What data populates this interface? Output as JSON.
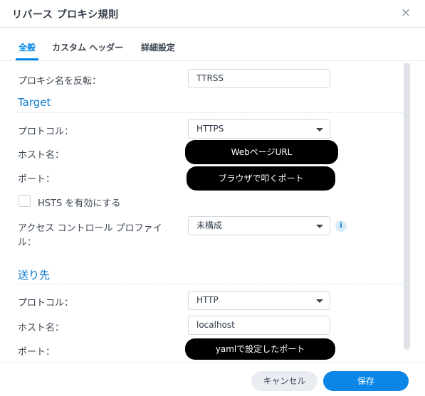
{
  "dialog": {
    "title": "リバース プロキシ規則",
    "close_icon": "×"
  },
  "tabs": [
    {
      "label": "全般",
      "active": true
    },
    {
      "label": "カスタム ヘッダー",
      "active": false
    },
    {
      "label": "詳細設定",
      "active": false
    }
  ],
  "general": {
    "proxy_name_label": "プロキシ名を反転：",
    "proxy_name_value": "TTRSS"
  },
  "target": {
    "section_title": "Target",
    "protocol_label": "プロトコル：",
    "protocol_value": "HTTPS",
    "hostname_label": "ホスト名：",
    "hostname_redacted": "WebページURL",
    "port_label": "ポート：",
    "port_redacted": "ブラウザで叩くポート",
    "hsts_label": "HSTS を有効にする",
    "hsts_checked": false,
    "acl_label_line1": "アクセス コントロール プロファイ",
    "acl_label_line2": "ル：",
    "acl_value": "未構成",
    "info_icon": "i"
  },
  "destination": {
    "section_title": "送り先",
    "protocol_label": "プロトコル：",
    "protocol_value": "HTTP",
    "hostname_label": "ホスト名：",
    "hostname_value": "localhost",
    "port_label": "ポート：",
    "port_redacted": "yamlで設定したポート"
  },
  "footer": {
    "cancel_label": "キャンセル",
    "save_label": "保存"
  }
}
